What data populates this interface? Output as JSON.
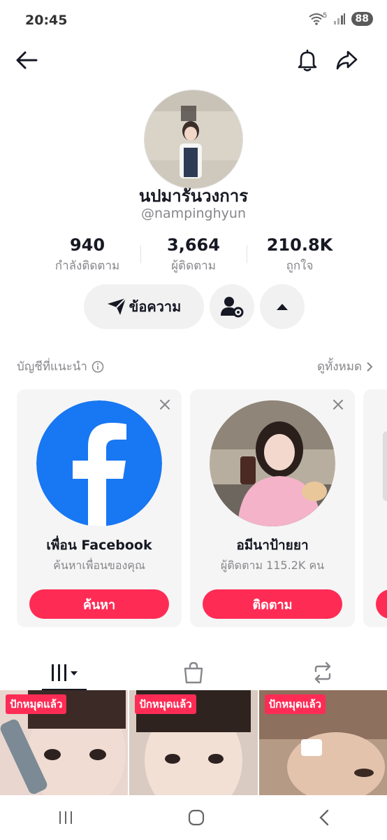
{
  "status": {
    "time": "20:45",
    "battery": "88",
    "network": "5"
  },
  "profile": {
    "display_name": "นปมารันวงการ",
    "username": "@nampinghyun",
    "stats": [
      {
        "value": "940",
        "label": "กำลังติดตาม"
      },
      {
        "value": "3,664",
        "label": "ผู้ติดตาม"
      },
      {
        "value": "210.8K",
        "label": "ถูกใจ"
      }
    ],
    "message_label": "ข้อความ"
  },
  "suggested": {
    "title": "บัญชีที่แนะนำ",
    "see_all": "ดูทั้งหมด",
    "cards": [
      {
        "name": "เพื่อน Facebook",
        "sub": "ค้นหาเพื่อนของคุณ",
        "button": "ค้นหา"
      },
      {
        "name": "อมีนาป้ายยา",
        "sub": "ผู้ติดตาม 115.2K คน",
        "button": "ติดตาม"
      }
    ]
  },
  "videos": [
    {
      "badge": "ปักหมุดแล้ว"
    },
    {
      "badge": "ปักหมุดแล้ว"
    },
    {
      "badge": "ปักหมุดแล้ว"
    }
  ],
  "colors": {
    "accent": "#fe2c55",
    "facebook": "#1877f2"
  }
}
